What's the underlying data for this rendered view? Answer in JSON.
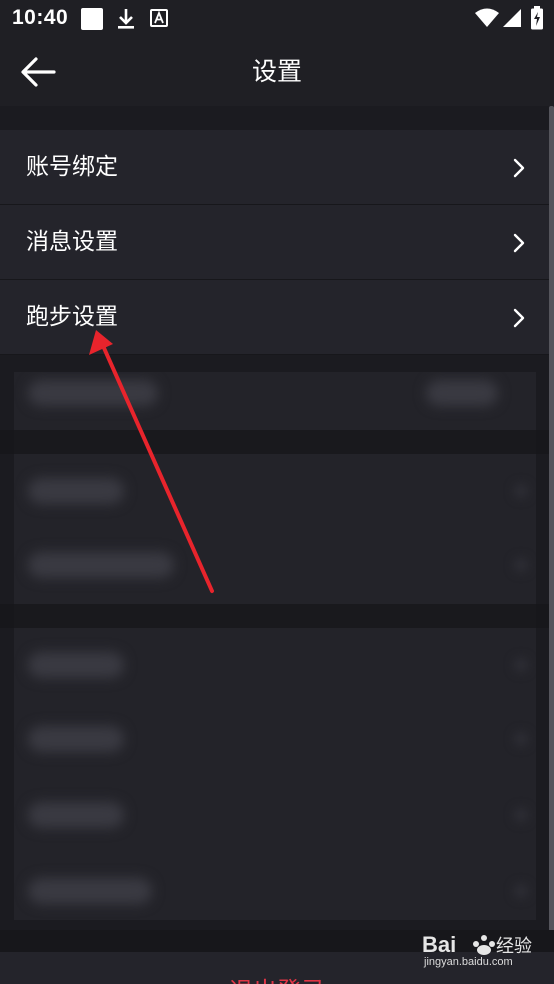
{
  "status_bar": {
    "time": "10:40",
    "icons": [
      "square-icon",
      "download-icon",
      "a-box-icon",
      "wifi-icon",
      "signal-icon",
      "battery-icon"
    ]
  },
  "header": {
    "back_icon": "arrow-left-icon",
    "title": "设置"
  },
  "settings": {
    "items": [
      {
        "label": "账号绑定",
        "icon": "chevron-right-icon"
      },
      {
        "label": "消息设置",
        "icon": "chevron-right-icon"
      },
      {
        "label": "跑步设置",
        "icon": "chevron-right-icon"
      }
    ]
  },
  "footer": {
    "logout_label": "退出登录"
  },
  "watermark": {
    "brand": "Baidu经验",
    "url": "jingyan.baidu.com"
  },
  "colors": {
    "background": "#1b1b20",
    "row": "#24242b",
    "logout": "#e03546",
    "annotation": "#e8242c"
  }
}
